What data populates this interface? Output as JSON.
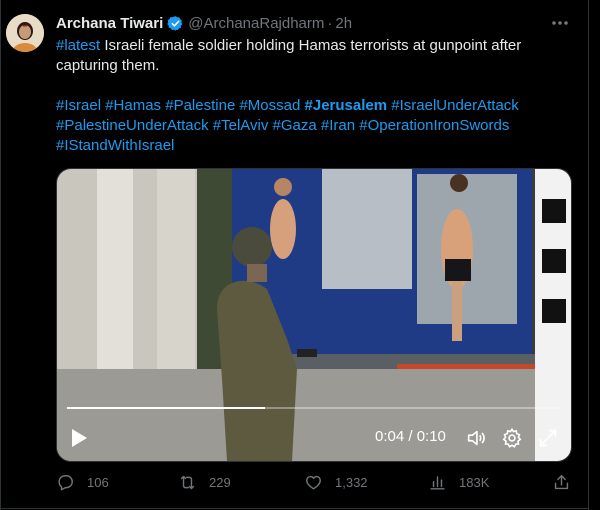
{
  "tweet": {
    "author_name": "Archana Tiwari",
    "author_handle": "@ArchanaRajdharm",
    "separator": "·",
    "time": "2h",
    "text_hashtag": "#latest",
    "text_body": "Israeli female soldier holding Hamas terrorists at gunpoint after capturing them.",
    "tags_line1": [
      {
        "text": "#Israel",
        "bold": false
      },
      {
        "text": "#Hamas",
        "bold": false
      },
      {
        "text": "#Palestine",
        "bold": false
      },
      {
        "text": "#Mossad",
        "bold": false
      },
      {
        "text": "#Jerusalem",
        "bold": true
      },
      {
        "text": "#IsraelUnderAttack",
        "bold": false
      }
    ],
    "tags_line2": [
      {
        "text": "#PalestineUnderAttack",
        "bold": false
      },
      {
        "text": "#TelAviv",
        "bold": false
      },
      {
        "text": "#Gaza",
        "bold": false
      },
      {
        "text": "#Iran",
        "bold": false
      },
      {
        "text": "#OperationIronSwords",
        "bold": false
      }
    ],
    "tags_line3": [
      {
        "text": "#IStandWithIsrael",
        "bold": false
      }
    ]
  },
  "video": {
    "current_time": "0:04",
    "duration": "0:10",
    "time_display": "0:04 / 0:10",
    "progress": 0.4
  },
  "actions": {
    "replies": "106",
    "reposts": "229",
    "likes": "1,332",
    "views": "183K"
  },
  "colors": {
    "background": "#000000",
    "text": "#e7e9ea",
    "muted": "#71767b",
    "link": "#1d9bf0",
    "verified": "#1d9bf0"
  },
  "icons": [
    "verified-badge-icon",
    "more-options-icon",
    "play-icon",
    "volume-icon",
    "settings-gear-icon",
    "fullscreen-icon",
    "reply-icon",
    "repost-icon",
    "like-icon",
    "views-icon",
    "share-icon"
  ]
}
